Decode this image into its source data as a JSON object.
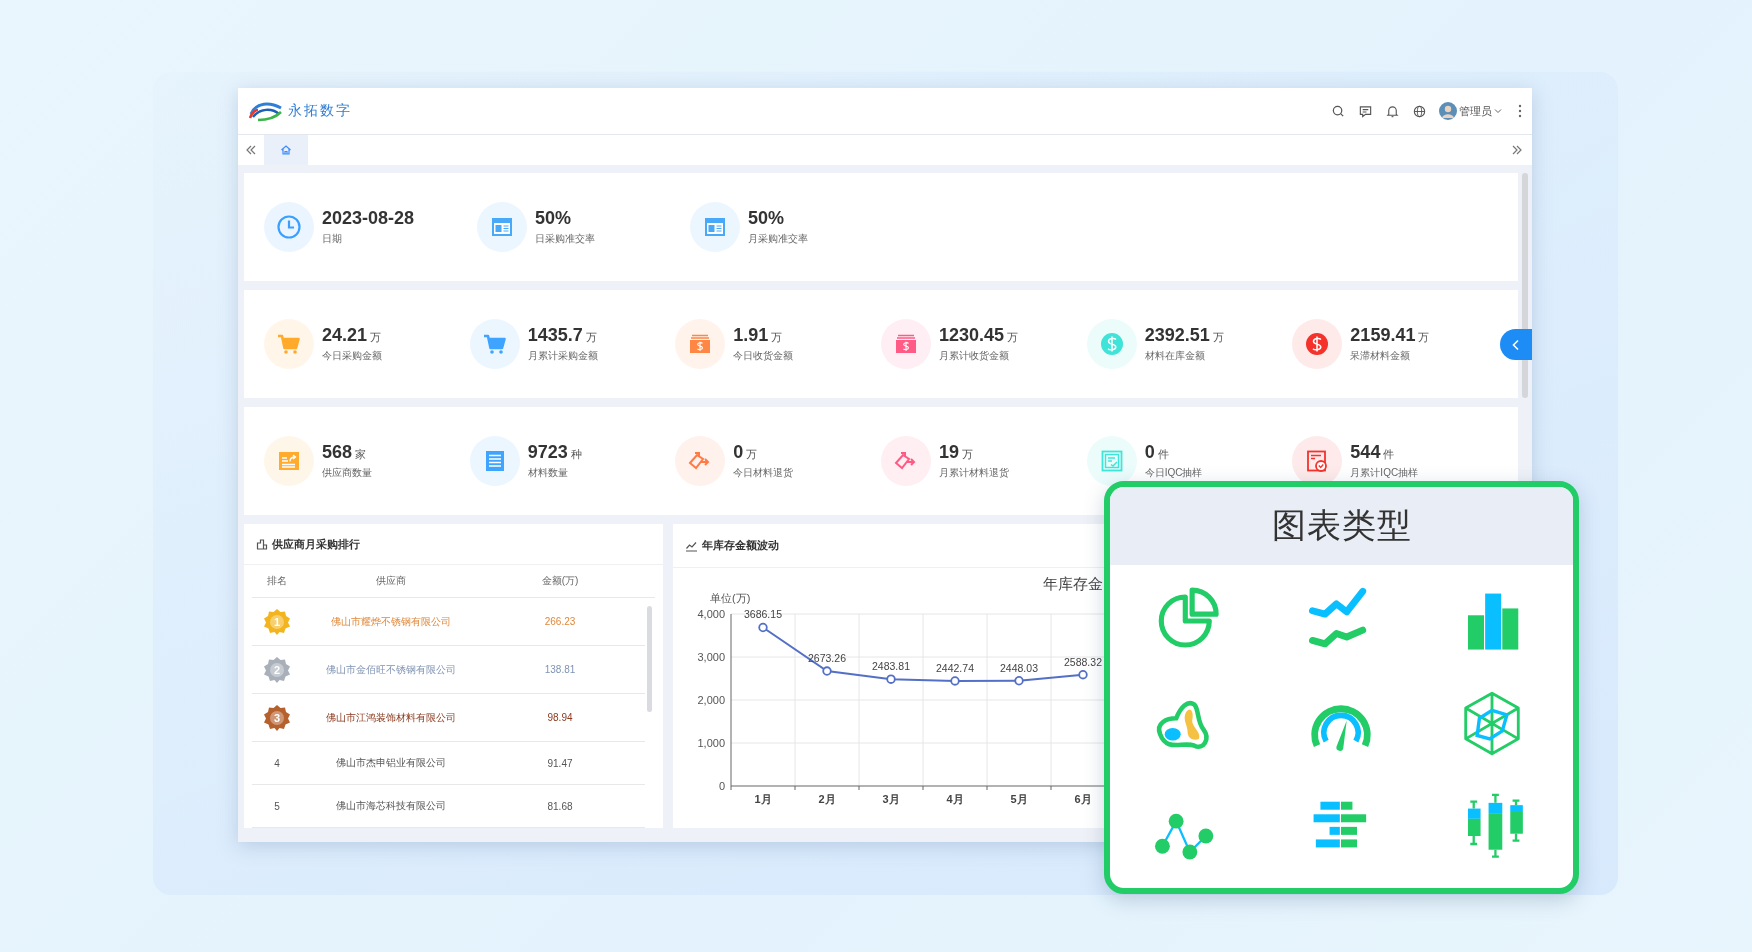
{
  "header": {
    "brand": "永拓数字",
    "user": "管理员"
  },
  "tabs": [
    {
      "kind": "home",
      "selected": true
    }
  ],
  "stat_rows": [
    {
      "items": [
        {
          "kind": "clock",
          "value": "2023-08-28",
          "label": "日期",
          "color": "#3aa0ff"
        },
        {
          "kind": "window",
          "value": "50%",
          "label": "日采购准交率",
          "color": "#47a9f7"
        },
        {
          "kind": "window",
          "value": "50%",
          "label": "月采购准交率",
          "color": "#47a9f7"
        }
      ]
    },
    {
      "items": [
        {
          "kind": "cart",
          "value": "24.21",
          "unit": "万",
          "label": "今日采购金额",
          "color": "#ffaa2b"
        },
        {
          "kind": "cart",
          "value": "1435.7",
          "unit": "万",
          "label": "月累计采购金额",
          "color": "#3ea4ff"
        },
        {
          "kind": "cash",
          "value": "1.91",
          "unit": "万",
          "label": "今日收货金额",
          "color": "#ff8746"
        },
        {
          "kind": "cash",
          "value": "1230.45",
          "unit": "万",
          "label": "月累计收货金额",
          "color": "#ff5b86"
        },
        {
          "kind": "dollar",
          "value": "2392.51",
          "unit": "万",
          "label": "材料在库金额",
          "color": "#3fe3d7"
        },
        {
          "kind": "dollar",
          "value": "2159.41",
          "unit": "万",
          "label": "呆滞材料金额",
          "color": "#f5312c"
        }
      ]
    },
    {
      "items": [
        {
          "kind": "image-card",
          "value": "568",
          "unit": "家",
          "label": "供应商数量",
          "color": "#ffab2e"
        },
        {
          "kind": "list",
          "value": "9723",
          "unit": "种",
          "label": "材料数量",
          "color": "#3ea4fe"
        },
        {
          "kind": "return",
          "value": "0",
          "unit": "万",
          "label": "今日材料退货",
          "color": "#ff7a45"
        },
        {
          "kind": "return",
          "value": "19",
          "unit": "万",
          "label": "月累计材料退货",
          "color": "#ff5a84"
        },
        {
          "kind": "check-doc",
          "value": "0",
          "unit": "件",
          "label": "今日IQC抽样",
          "color": "#3ee5d8"
        },
        {
          "kind": "doc-badge",
          "value": "544",
          "unit": "件",
          "label": "月累计IQC抽样",
          "color": "#f5322d"
        }
      ]
    }
  ],
  "supplier_ranking": {
    "title": "供应商月采购排行",
    "columns": [
      "排名",
      "供应商",
      "金额(万)"
    ],
    "rows": [
      {
        "kind": "gold",
        "rank": "1",
        "name": "佛山市耀烨不锈钢有限公司",
        "amount": "266.23"
      },
      {
        "kind": "silver",
        "rank": "2",
        "name": "佛山市金佰旺不锈钢有限公司",
        "amount": "138.81"
      },
      {
        "kind": "bronze",
        "rank": "3",
        "name": "佛山市江鸿装饰材料有限公司",
        "amount": "98.94"
      },
      {
        "kind": "plain",
        "rank": "4",
        "name": "佛山市杰申铝业有限公司",
        "amount": "91.47"
      },
      {
        "kind": "plain",
        "rank": "5",
        "name": "佛山市海芯科技有限公司",
        "amount": "81.68"
      }
    ]
  },
  "inventory_chart": {
    "title": "年库存金额波动",
    "chart_data": {
      "type": "line",
      "title": "年库存金",
      "ylabel": "单位(万)",
      "categories": [
        "1月",
        "2月",
        "3月",
        "4月",
        "5月",
        "6月"
      ],
      "series": [
        {
          "color": "#5470c6",
          "marker": true,
          "values": [
            3686.15,
            2673.26,
            2483.81,
            2442.74,
            2448.03,
            2588.32
          ]
        }
      ],
      "grid": true,
      "ylim": [
        0,
        4000
      ],
      "yticks": [
        {
          "value": 0,
          "label": "0"
        },
        {
          "value": 1000,
          "label": "1,000"
        },
        {
          "value": 2000,
          "label": "2,000"
        },
        {
          "value": 3000,
          "label": "3,000"
        },
        {
          "value": 4000,
          "label": "4,000"
        }
      ],
      "data_labels": true
    }
  },
  "chart_types": {
    "title": "图表类型",
    "icons": [
      {
        "kind": "pie"
      },
      {
        "kind": "lines"
      },
      {
        "kind": "bars"
      },
      {
        "kind": "map"
      },
      {
        "kind": "gauge"
      },
      {
        "kind": "radar"
      },
      {
        "kind": "scatter"
      },
      {
        "kind": "hbars"
      },
      {
        "kind": "candles"
      }
    ]
  }
}
